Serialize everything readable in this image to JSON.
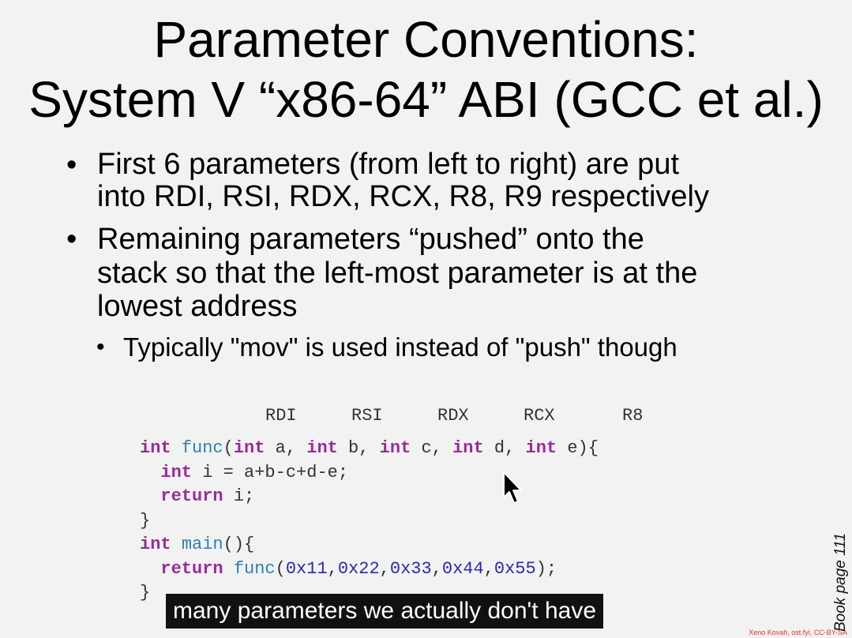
{
  "slide": {
    "title_line1": "Parameter Conventions:",
    "title_line2": "System V “x86-64” ABI (GCC et al.)",
    "bullets": [
      {
        "lines": [
          "First 6 parameters (from left to right) are put",
          "into RDI, RSI, RDX, RCX, R8, R9 respectively"
        ]
      },
      {
        "lines": [
          "Remaining parameters “pushed” onto the",
          "stack so that the left-most parameter is at the",
          "lowest address"
        ]
      }
    ],
    "sub_bullet": "Typically \"mov\" is used instead of \"push\" though",
    "registers": [
      "RDI",
      "RSI",
      "RDX",
      "RCX",
      "R8"
    ],
    "code": {
      "l1": {
        "kw1": "int",
        "fn": "func",
        "p0": "(",
        "kw2": "int",
        "t2": " a, ",
        "kw3": "int",
        "t3": " b, ",
        "kw4": "int",
        "t4": " c, ",
        "kw5": "int",
        "t5": " d, ",
        "kw6": "int",
        "t6": " e){"
      },
      "l2": {
        "kw": "int",
        "rest": " i = a+b-c+d-e;"
      },
      "l3": {
        "kw": "return",
        "rest": " i;"
      },
      "l4": "}",
      "l5": {
        "kw": "int",
        "fn": "main",
        "rest": "(){"
      },
      "l6": {
        "kw": "return",
        "fn": "func",
        "open": "(",
        "n1": "0x11",
        "c1": ",",
        "n2": "0x22",
        "c2": ",",
        "n3": "0x33",
        "c3": ",",
        "n4": "0x44",
        "c4": ",",
        "n5": "0x55",
        "close": ");"
      },
      "l7": "}"
    },
    "book_page": "Book page 111",
    "credit": "Xeno Kovah, ost.fyi, CC-BY-SA"
  },
  "caption": "many parameters we actually don't have",
  "colors": {
    "keyword": "#9a2a9a",
    "function": "#2f7fb0",
    "number": "#2a2ab0",
    "credit": "#d93a2b"
  }
}
